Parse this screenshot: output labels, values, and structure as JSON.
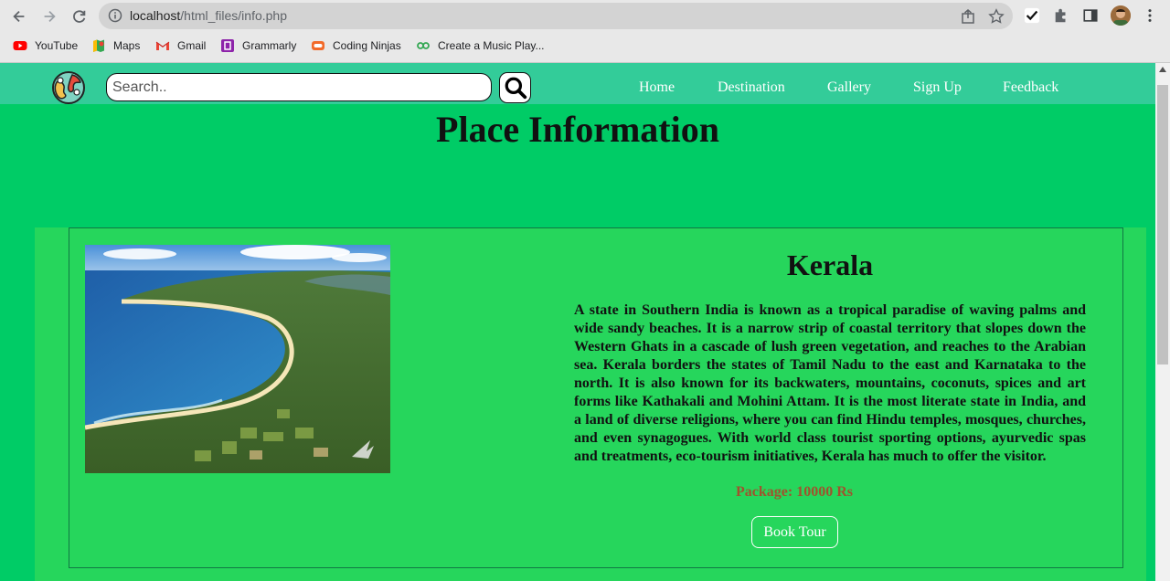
{
  "browser": {
    "url_host": "localhost",
    "url_path": "/html_files/info.php",
    "bookmarks": [
      {
        "label": "YouTube",
        "icon": "youtube-icon"
      },
      {
        "label": "Maps",
        "icon": "maps-icon"
      },
      {
        "label": "Gmail",
        "icon": "gmail-icon"
      },
      {
        "label": "Grammarly",
        "icon": "grammarly-icon"
      },
      {
        "label": "Coding Ninjas",
        "icon": "coding-ninjas-icon"
      },
      {
        "label": "Create a Music Play...",
        "icon": "music-play-icon"
      }
    ]
  },
  "site": {
    "search_placeholder": "Search..",
    "menu": [
      "Home",
      "Destination",
      "Gallery",
      "Sign Up",
      "Feedback"
    ],
    "page_title": "Place Information"
  },
  "place": {
    "name": "Kerala",
    "description": "A state in Southern India is known as a tropical paradise of waving palms and wide sandy beaches. It is a narrow strip of coastal territory that slopes down the Western Ghats in a cascade of lush green vegetation, and reaches to the Arabian sea. Kerala borders the states of Tamil Nadu to the east and Karnataka to the north. It is also known for its backwaters, mountains, coconuts, spices and art forms like Kathakali and Mohini Attam. It is the most literate state in India, and a land of diverse religions, where you can find Hindu temples, mosques, churches, and even synagogues. With world class tourist sporting options, ayurvedic spas and treatments, eco-tourism initiatives, Kerala has much to offer the visitor.",
    "package": "Package: 10000 Rs",
    "book_label": "Book Tour"
  },
  "colors": {
    "page_bg": "#00cc66",
    "nav_bg": "#33cc99",
    "card_bg": "#26d65c",
    "package_text": "#a0522d"
  }
}
